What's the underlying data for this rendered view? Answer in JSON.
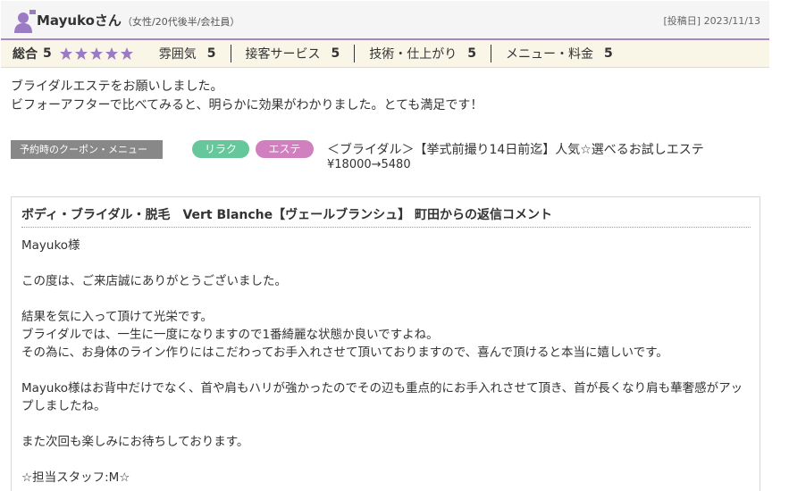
{
  "header": {
    "reviewer_name": "Mayukoさん",
    "reviewer_info": "（女性/20代後半/会社員）",
    "post_date": "[投稿日] 2023/11/13",
    "avatar_icon": "user-icon"
  },
  "ratings": {
    "total_label": "総合",
    "total_score": "5",
    "star_count": 5,
    "star_color": "#9b7cc4",
    "items": [
      {
        "label": "雰囲気",
        "score": "5"
      },
      {
        "label": "接客サービス",
        "score": "5"
      },
      {
        "label": "技術・仕上がり",
        "score": "5"
      },
      {
        "label": "メニュー・料金",
        "score": "5"
      }
    ]
  },
  "review": {
    "lines": [
      "ブライダルエステをお願いしました。",
      "ビフォーアフターで比べてみると、明らかに効果がわかりました。とても満足です！"
    ]
  },
  "coupon": {
    "label": "予約時のクーポン・メニュー",
    "tags": [
      "リラク",
      "エステ"
    ],
    "title": "＜ブライダル＞【挙式前撮り14日前迄】人気☆選べるお試しエステ",
    "price": "¥18000→5480"
  },
  "reply": {
    "title": "ボディ・ブライダル・脱毛　Vert Blanche【ヴェールブランシュ】 町田からの返信コメント",
    "greeting": "Mayuko様",
    "para1": "この度は、ご来店誠にありがとうございました。",
    "para2_lines": [
      "結果を気に入って頂けて光栄です。",
      "ブライダルでは、一生に一度になりますので1番綺麗な状態か良いですよね。",
      "その為に、お身体のライン作りにはこだわってお手入れさせて頂いておりますので、喜んで頂けると本当に嬉しいです。"
    ],
    "para3": "Mayuko様はお背中だけでなく、首や肩もハリが強かったのでその辺も重点的にお手入れさせて頂き、首が長くなり肩も華奢感がアップしましたね。",
    "para4": "また次回も楽しみにお待ちしております。",
    "staff": "☆担当スタッフ:M☆"
  }
}
